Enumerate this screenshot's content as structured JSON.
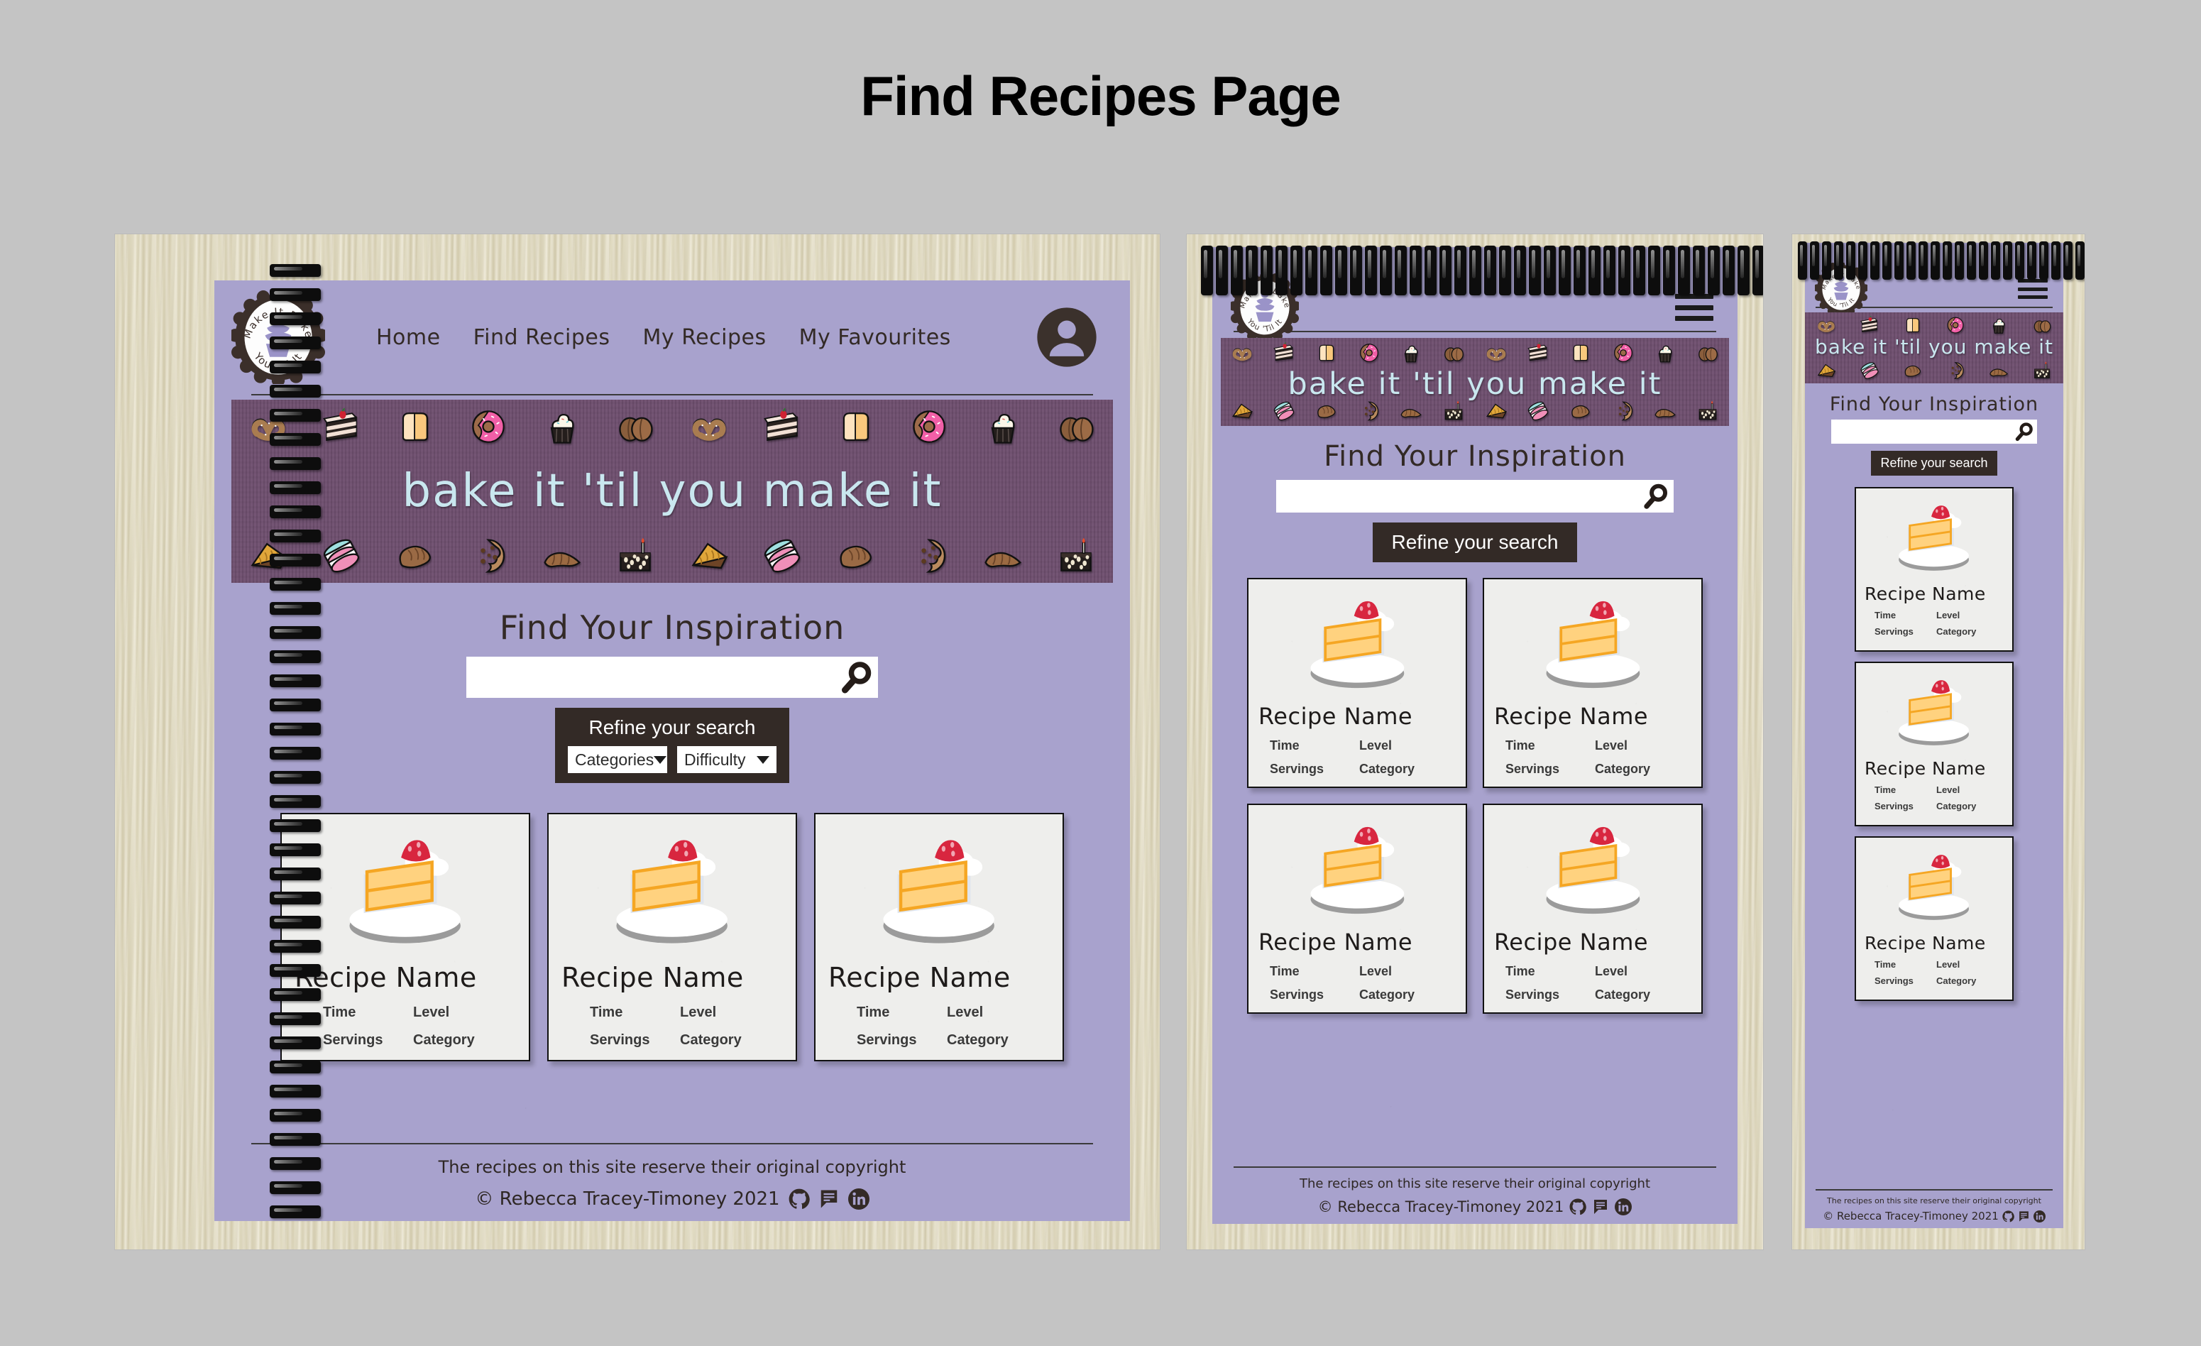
{
  "page": {
    "title": "Find Recipes Page",
    "background_color": "#c4c4c4"
  },
  "theme": {
    "paper_lavender": "#a8a2cd",
    "banner_purple": "#6f5070",
    "dark_brown": "#332a26",
    "banner_text_blue": "#c9e7ef",
    "card_bg": "#eeeeec",
    "wood_light": "#e4dfc8"
  },
  "site": {
    "logo": {
      "name": "make-it-bake-it-logo",
      "text_top": "Make It Bake",
      "text_bottom": "You 'Til It"
    },
    "nav": {
      "items": [
        {
          "label": "Home"
        },
        {
          "label": "Find Recipes"
        },
        {
          "label": "My Recipes"
        },
        {
          "label": "My Favourites"
        }
      ],
      "avatar_icon": "account-avatar-icon",
      "burger_icon": "hamburger-menu-icon"
    },
    "banner": {
      "text": "bake it 'til you make it",
      "icons_top": [
        "pretzel",
        "layer-cake-slice",
        "bread-slice",
        "donut",
        "cupcake",
        "bread-rolls"
      ],
      "icons_bottom": [
        "pie-slice",
        "macaron",
        "bread-loaf",
        "cookie",
        "croissant",
        "birthday-cake"
      ]
    },
    "search": {
      "heading": "Find Your Inspiration",
      "input_value": "",
      "input_placeholder": "",
      "search_icon": "magnifier-icon"
    },
    "refine": {
      "title": "Refine your search",
      "filters": [
        {
          "label": "Categories",
          "caret": "chevron-down-icon"
        },
        {
          "label": "Difficulty",
          "caret": "chevron-down-icon"
        }
      ]
    },
    "recipe_card": {
      "image_alt": "cake-slice-illustration",
      "title": "Recipe Name",
      "meta": [
        "Time",
        "Level",
        "Servings",
        "Category"
      ]
    },
    "footer": {
      "line1": "The recipes on this site reserve their original copyright",
      "line2": "© Rebecca Tracey-Timoney 2021",
      "social": [
        {
          "name": "github-icon"
        },
        {
          "name": "slack-icon"
        },
        {
          "name": "linkedin-icon"
        }
      ]
    }
  },
  "mockups": [
    {
      "id": "desktop",
      "device": "desktop-notebook-mockup",
      "card_count": 3,
      "refine_expanded": true,
      "nav_style": "links"
    },
    {
      "id": "tablet",
      "device": "tablet-notebook-mockup",
      "card_count": 4,
      "refine_expanded": false,
      "nav_style": "burger"
    },
    {
      "id": "mobile",
      "device": "mobile-notebook-mockup",
      "card_count": 3,
      "refine_expanded": false,
      "nav_style": "burger"
    }
  ]
}
